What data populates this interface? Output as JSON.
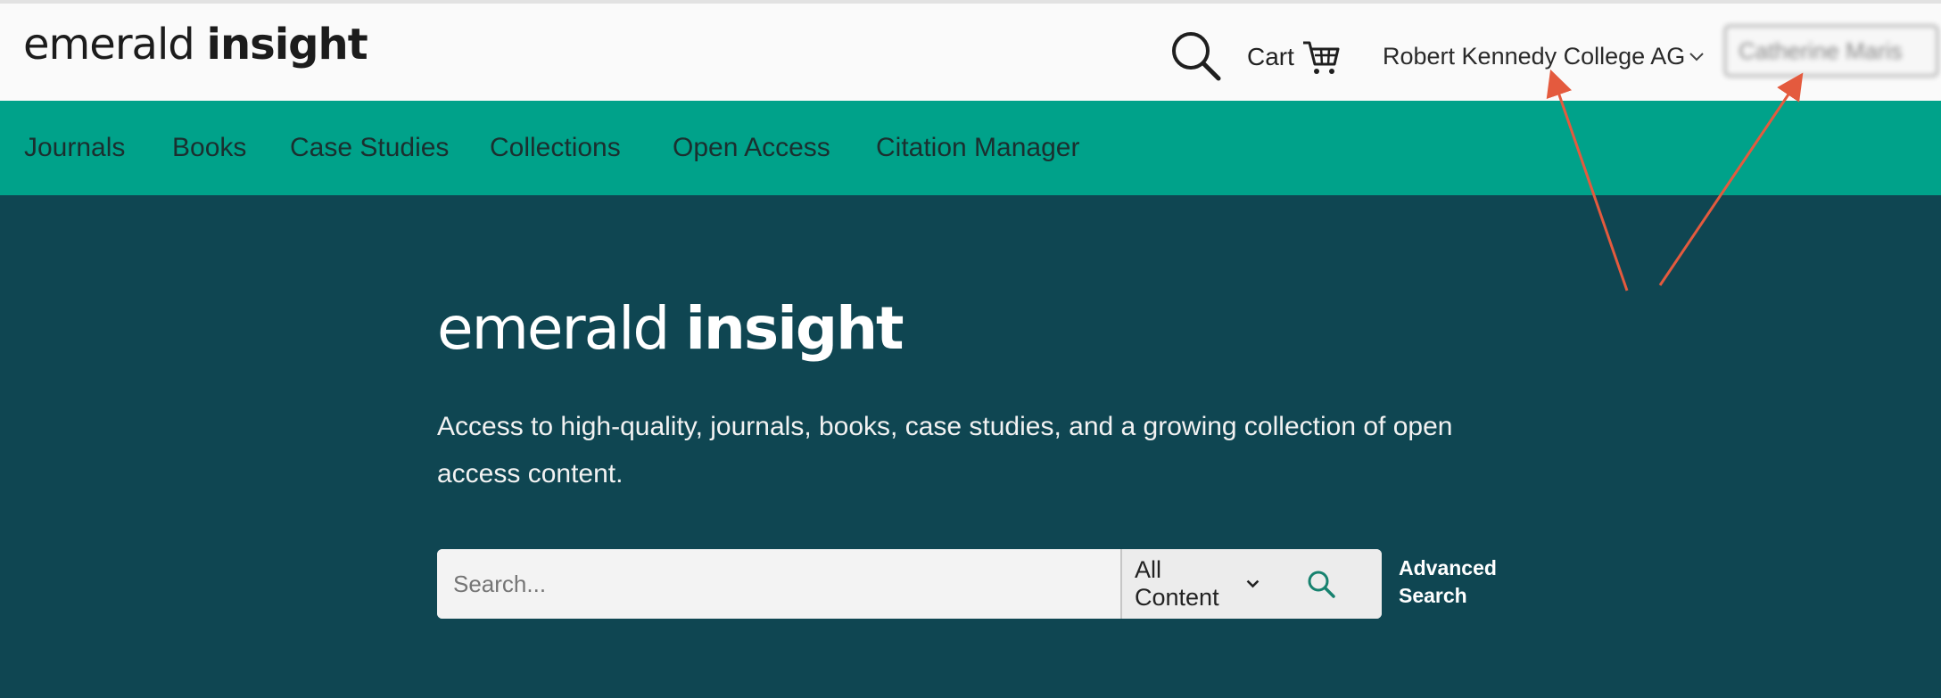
{
  "header": {
    "logo_light": "emerald",
    "logo_bold": "insight",
    "cart_label": "Cart",
    "institution": "Robert Kennedy College AG",
    "user_name": "Catherine Maris"
  },
  "nav": {
    "items": [
      {
        "label": "Journals"
      },
      {
        "label": "Books"
      },
      {
        "label": "Case Studies"
      },
      {
        "label": "Collections"
      },
      {
        "label": "Open Access"
      },
      {
        "label": "Citation Manager"
      }
    ]
  },
  "hero": {
    "logo_light": "emerald",
    "logo_bold": "insight",
    "tagline": "Access to high-quality, journals, books, case studies, and a growing collection of open access content."
  },
  "search": {
    "placeholder": "Search...",
    "content_filter": "All Content",
    "advanced_line1": "Advanced",
    "advanced_line2": "Search"
  },
  "colors": {
    "nav_bg": "#00a28a",
    "hero_bg": "#0f4652",
    "annotation_arrow": "#e45a3e"
  }
}
